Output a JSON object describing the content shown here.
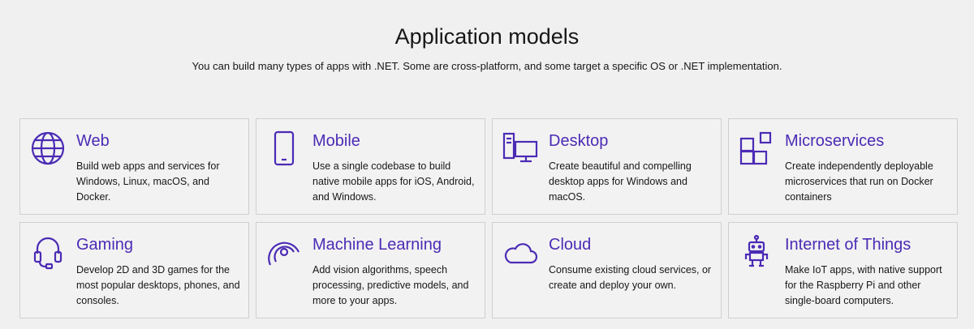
{
  "heading": {
    "title": "Application models",
    "subtitle": "You can build many types of apps with .NET. Some are cross-platform, and some target a specific OS or .NET implementation."
  },
  "accent_color": "#4b2bb5",
  "cards": [
    {
      "title": "Web",
      "description": "Build web apps and services for Windows, Linux, macOS, and Docker.",
      "icon": "globe-icon"
    },
    {
      "title": "Mobile",
      "description": "Use a single codebase to build native mobile apps for iOS, Android, and Windows.",
      "icon": "phone-icon"
    },
    {
      "title": "Desktop",
      "description": "Create beautiful and compelling desktop apps for Windows and macOS.",
      "icon": "desktop-icon"
    },
    {
      "title": "Microservices",
      "description": "Create independently deployable microservices that run on Docker containers",
      "icon": "microservices-icon"
    },
    {
      "title": "Gaming",
      "description": "Develop 2D and 3D games for the most popular desktops, phones, and consoles.",
      "icon": "headset-icon"
    },
    {
      "title": "Machine Learning",
      "description": "Add vision algorithms, speech processing, predictive models, and more to your apps.",
      "icon": "ml-icon"
    },
    {
      "title": "Cloud",
      "description": "Consume existing cloud services, or create and deploy your own.",
      "icon": "cloud-icon"
    },
    {
      "title": "Internet of Things",
      "description": "Make IoT apps, with native support for the Raspberry Pi and other single-board computers.",
      "icon": "robot-icon"
    }
  ]
}
